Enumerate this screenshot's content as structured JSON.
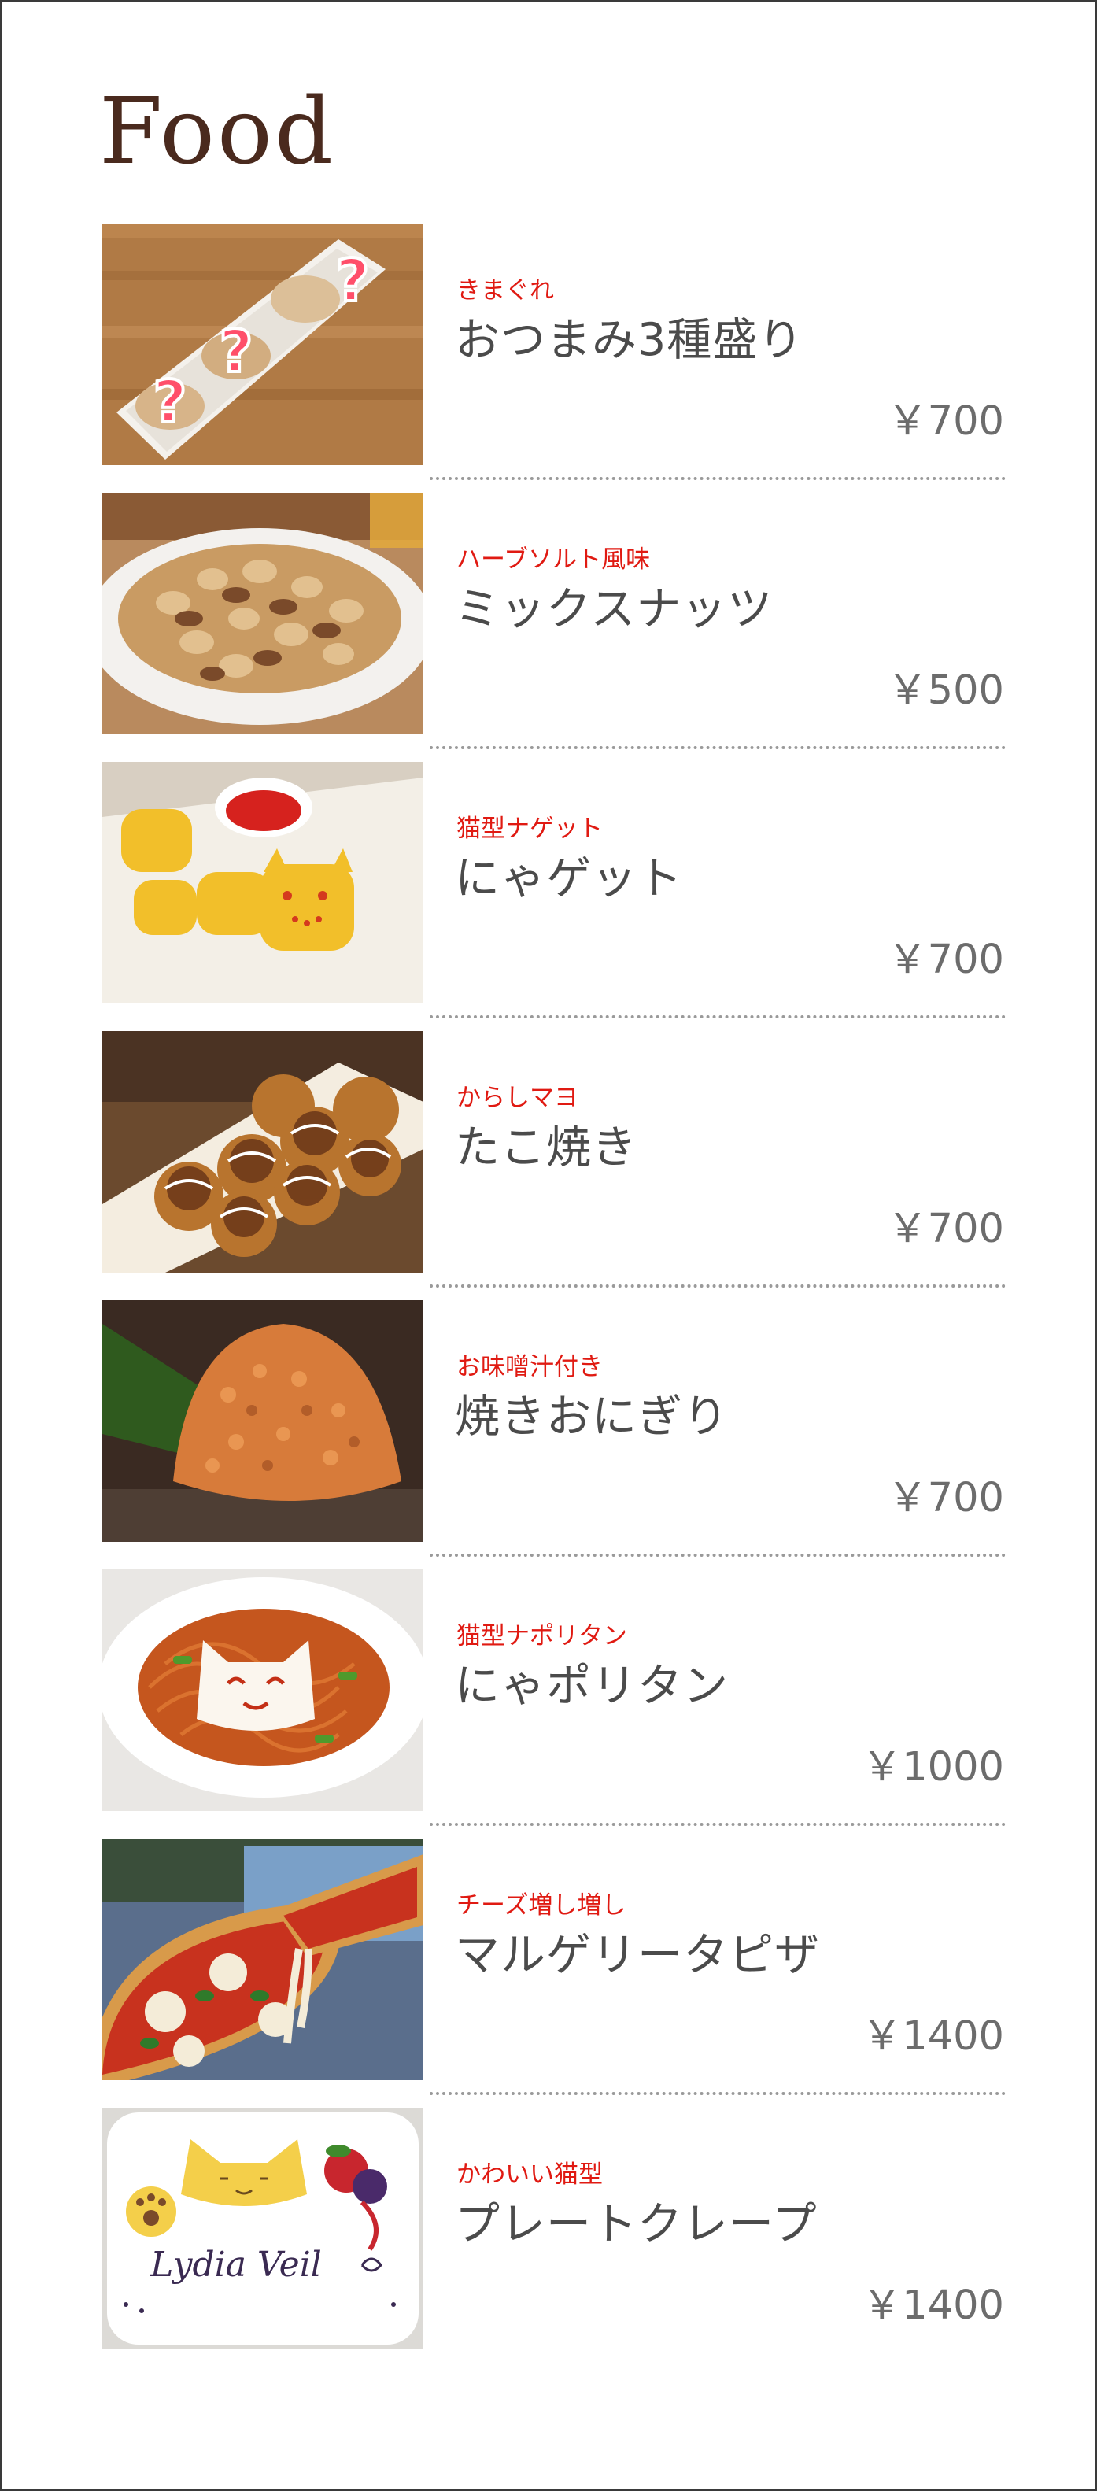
{
  "page_title": "Food",
  "items": [
    {
      "subtitle": "きまぐれ",
      "name": "おつまみ3種盛り",
      "price": "￥700",
      "image": "snack-platter-photo"
    },
    {
      "subtitle": "ハーブソルト風味",
      "name": "ミックスナッツ",
      "price": "￥500",
      "image": "mixed-nuts-photo"
    },
    {
      "subtitle": "猫型ナゲット",
      "name": "にゃゲット",
      "price": "￥700",
      "image": "cat-nuggets-photo"
    },
    {
      "subtitle": "からしマヨ",
      "name": "たこ焼き",
      "price": "￥700",
      "image": "takoyaki-photo"
    },
    {
      "subtitle": "お味噌汁付き",
      "name": "焼きおにぎり",
      "price": "￥700",
      "image": "grilled-rice-ball-photo"
    },
    {
      "subtitle": "猫型ナポリタン",
      "name": "にゃポリタン",
      "price": "￥1000",
      "image": "cat-napolitan-photo"
    },
    {
      "subtitle": "チーズ増し増し",
      "name": "マルゲリータピザ",
      "price": "￥1400",
      "image": "margherita-pizza-photo"
    },
    {
      "subtitle": "かわいい猫型",
      "name": "プレートクレープ",
      "price": "￥1400",
      "image": "cat-crepe-plate-photo"
    }
  ],
  "plate_lettering": "Lydia Veil",
  "colors": {
    "title": "#4a2a1e",
    "subtitle": "#e01a12",
    "name": "#4b4b4b",
    "price": "#6c6c6c",
    "divider": "#9a9a9a"
  }
}
